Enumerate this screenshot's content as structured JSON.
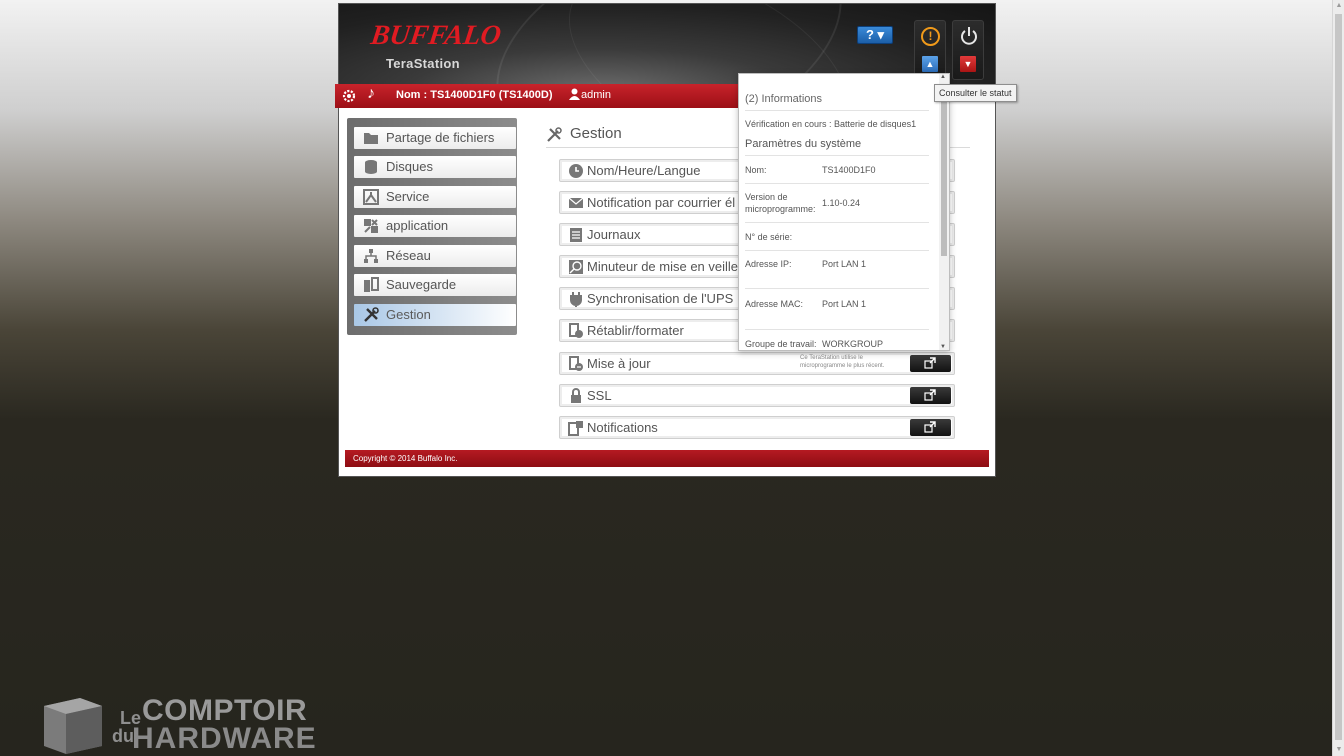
{
  "header": {
    "brand": "BUFFALO",
    "product": "TeraStation",
    "help_label": "?"
  },
  "topbar": {
    "name_label": "Nom : TS1400D1F0 (TS1400D)",
    "user_label": "admin"
  },
  "sidebar": {
    "items": [
      {
        "label": "Partage de fichiers",
        "icon": "folder-icon"
      },
      {
        "label": "Disques",
        "icon": "disk-icon"
      },
      {
        "label": "Service",
        "icon": "service-icon"
      },
      {
        "label": "application",
        "icon": "application-icon"
      },
      {
        "label": "Réseau",
        "icon": "network-icon"
      },
      {
        "label": "Sauvegarde",
        "icon": "backup-icon"
      },
      {
        "label": "Gestion",
        "icon": "tools-icon",
        "active": true
      }
    ]
  },
  "main": {
    "title": "Gestion",
    "menu": [
      {
        "label": "Nom/Heure/Langue",
        "icon": "clock-icon"
      },
      {
        "label": "Notification par courrier él",
        "icon": "mail-icon"
      },
      {
        "label": "Journaux",
        "icon": "log-icon"
      },
      {
        "label": "Minuteur de mise en veille",
        "icon": "sleep-timer-icon"
      },
      {
        "label": "Synchronisation de l'UPS",
        "icon": "plug-icon"
      },
      {
        "label": "Rétablir/formater",
        "icon": "restore-icon"
      },
      {
        "label": "Mise à jour",
        "icon": "update-icon",
        "note": "Ce TeraStation utilise le microprogramme le plus récent."
      },
      {
        "label": "SSL",
        "icon": "lock-icon"
      },
      {
        "label": "Notifications",
        "icon": "notification-icon"
      }
    ]
  },
  "footer": {
    "copyright": "Copyright © 2014 Buffalo Inc."
  },
  "popup": {
    "heading": "(2) Informations",
    "check": "Vérification en cours : Batterie de disques1",
    "section": "Paramètres du système",
    "rows": [
      {
        "key": "Nom:",
        "value": "TS1400D1F0"
      },
      {
        "key": "Version de microprogramme:",
        "value": "1.10-0.24"
      },
      {
        "key": "N° de série:",
        "value": ""
      },
      {
        "key": "Adresse IP:",
        "value": "Port LAN 1"
      },
      {
        "key": "Adresse MAC:",
        "value": "Port LAN 1"
      },
      {
        "key": "Groupe de travail:",
        "value": "WORKGROUP"
      }
    ]
  },
  "tooltip": "Consulter le statut",
  "watermark": {
    "le": "Le",
    "du": "du",
    "comptoir": "COMPTOIR",
    "hardware": "HARDWARE"
  },
  "colors": {
    "brand_red": "#c8232b",
    "warning_orange": "#f09a1a",
    "help_blue": "#2b6cb8"
  }
}
